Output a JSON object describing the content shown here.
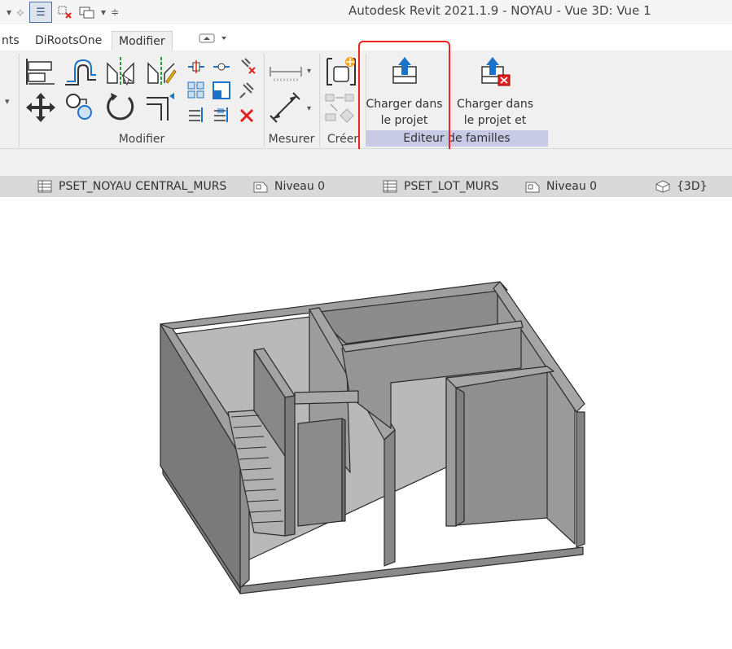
{
  "window": {
    "title": "Autodesk Revit 2021.1.9 - NOYAU - Vue 3D: Vue 1"
  },
  "tabs": [
    {
      "label": "nts",
      "active": false
    },
    {
      "label": "DiRootsOne",
      "active": false
    },
    {
      "label": "Modifier",
      "active": true
    }
  ],
  "ribbon": {
    "panels": {
      "modifier": "Modifier",
      "mesurer": "Mesurer",
      "creer": "Créer",
      "editeur": "Editeur de familles"
    },
    "load_into_project": {
      "line1": "Charger dans",
      "line2": "le projet"
    },
    "load_and_close": {
      "line1": "Charger dans",
      "line2": "le projet et fermer"
    }
  },
  "view_tabs": [
    {
      "label": "PSET_NOYAU CENTRAL_MURS",
      "icon": "schedule-icon"
    },
    {
      "label": "Niveau 0",
      "icon": "plan-view-icon"
    },
    {
      "label": "PSET_LOT_MURS",
      "icon": "schedule-icon"
    },
    {
      "label": "Niveau 0",
      "icon": "plan-view-icon"
    },
    {
      "label": "{3D}",
      "icon": "3d-view-icon"
    }
  ],
  "colors": {
    "highlight": "#e22222",
    "panel_band": "#c9cae6",
    "accent_blue": "#1a73c9"
  }
}
